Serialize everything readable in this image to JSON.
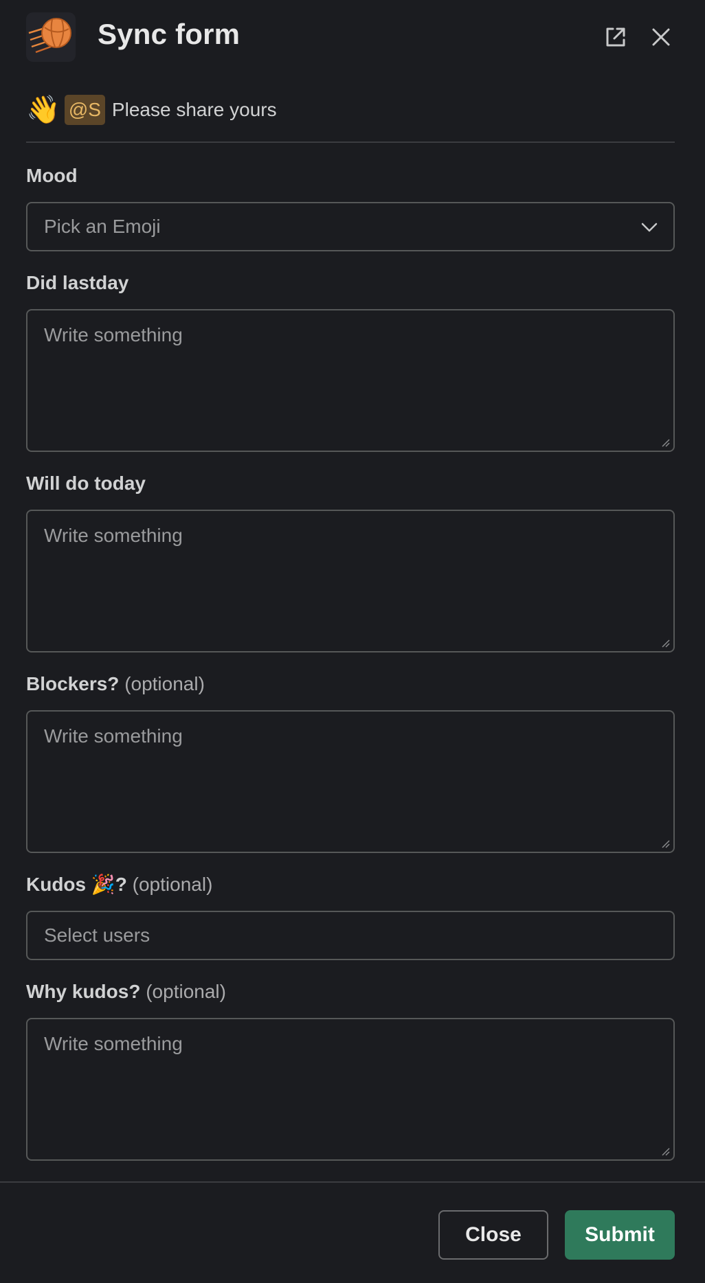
{
  "header": {
    "title": "Sync form",
    "app_icon": "ball-with-motion-lines-icon",
    "open_external_icon": "external-link-icon",
    "close_icon": "close-icon"
  },
  "intro": {
    "emoji": "👋",
    "mention": "@S",
    "text": "Please share yours"
  },
  "fields": {
    "mood": {
      "label": "Mood",
      "placeholder": "Pick an Emoji"
    },
    "did_lastday": {
      "label": "Did lastday",
      "placeholder": "Write something"
    },
    "will_do_today": {
      "label": "Will do today",
      "placeholder": "Write something"
    },
    "blockers": {
      "label": "Blockers?",
      "optional": "(optional)",
      "placeholder": "Write something"
    },
    "kudos": {
      "label": "Kudos",
      "emoji": "🎉",
      "suffix": "?",
      "optional": "(optional)",
      "placeholder": "Select users"
    },
    "why_kudos": {
      "label": "Why kudos?",
      "optional": "(optional)",
      "placeholder": "Write something"
    }
  },
  "footer": {
    "close_label": "Close",
    "submit_label": "Submit"
  },
  "colors": {
    "background": "#1b1c20",
    "submit": "#2f7a5b",
    "mention_bg": "#5b4528",
    "mention_fg": "#e8b865"
  }
}
